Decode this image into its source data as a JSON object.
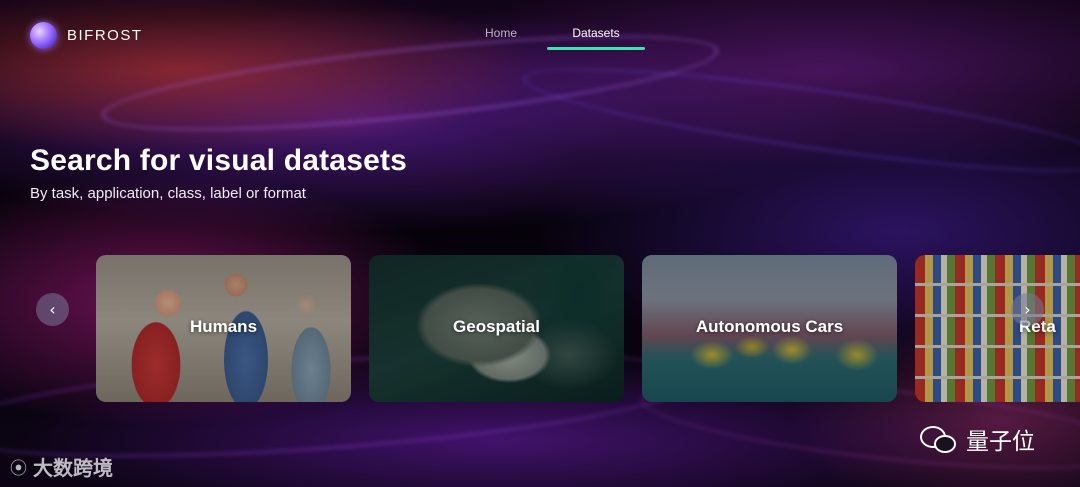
{
  "header": {
    "brand": "BIFROST",
    "nav": [
      {
        "label": "Home",
        "active": false
      },
      {
        "label": "Datasets",
        "active": true
      }
    ],
    "active_color": "#3fe3b0"
  },
  "hero": {
    "title": "Search for visual datasets",
    "subtitle": "By task, application, class, label or format"
  },
  "carousel": {
    "cards": [
      {
        "label": "Humans"
      },
      {
        "label": "Geospatial"
      },
      {
        "label": "Autonomous Cars"
      },
      {
        "label": "Reta"
      }
    ],
    "prev_icon": "chevron-left-icon",
    "next_icon": "chevron-right-icon"
  },
  "watermarks": {
    "left": "大数跨境",
    "right": "量子位"
  }
}
